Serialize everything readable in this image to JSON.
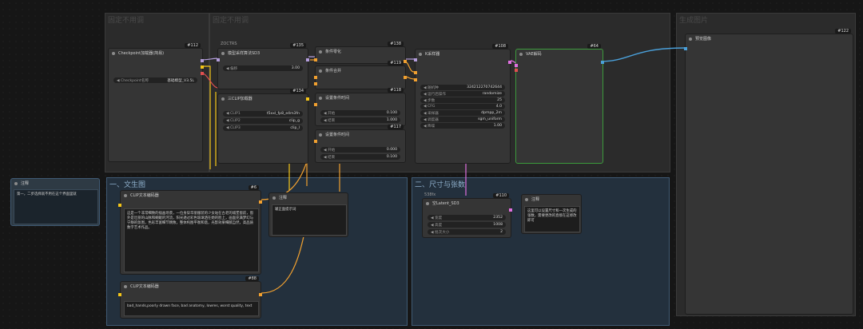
{
  "groups": {
    "g1": "固定不用调",
    "g2": "固定不用调",
    "g3": "生成图片",
    "g4": "一、文生图",
    "g5": "二、尺寸与张数"
  },
  "nodes": {
    "checkpoint": {
      "badge": "#112",
      "title": "Checkpoint加载器(简易)",
      "w_label": "Checkpoint名称",
      "w_value": "基础模型_V3.5L"
    },
    "sampler_sd3": {
      "sub": "ZOCTRS",
      "badge": "#135",
      "title": "模型采样算法SD3",
      "w_label": "偏移",
      "w_value": "3.00"
    },
    "condition_zero": {
      "badge": "#138",
      "title": "条件零化"
    },
    "condition_merge": {
      "badge": "#119",
      "title": "条件合并"
    },
    "clip_triple": {
      "badge": "#134",
      "title": "三CLIP加载器",
      "rows": [
        {
          "label": "CLIP1",
          "value": "t5xxl_fp8_e4m3fn"
        },
        {
          "label": "CLIP2",
          "value": "clip_g"
        },
        {
          "label": "CLIP3",
          "value": "clip_l"
        }
      ]
    },
    "set_cond_a": {
      "badge": "#118",
      "title": "设置条件时间",
      "rows": [
        {
          "label": "开始",
          "value": "0.100"
        },
        {
          "label": "结束",
          "value": "1.000"
        }
      ]
    },
    "set_cond_b": {
      "badge": "#117",
      "title": "设置条件时间",
      "rows": [
        {
          "label": "开始",
          "value": "0.000"
        },
        {
          "label": "结束",
          "value": "0.100"
        }
      ]
    },
    "ksampler": {
      "badge": "#108",
      "title": "K采样器",
      "rows": [
        {
          "label": "随机种",
          "value": "324212270742644"
        },
        {
          "label": "运行后操作",
          "value": "randomize"
        },
        {
          "label": "步数",
          "value": "25"
        },
        {
          "label": "CFG",
          "value": "4.0"
        },
        {
          "label": "采样器",
          "value": "dpmpp_2m"
        },
        {
          "label": "调度器",
          "value": "sgm_uniform"
        },
        {
          "label": "降噪",
          "value": "1.00"
        }
      ]
    },
    "vae": {
      "badge": "#64",
      "title": "VAE解码"
    },
    "preview": {
      "badge": "#122",
      "title": "预览图像"
    },
    "note_left": {
      "title": "注释",
      "text": "第一，二步选择就不用在这个界面里就"
    },
    "clip_text_pos": {
      "badge": "#6",
      "title": "CLIP文本编码器",
      "text": "这是一个非常细致的插画场景，一位身穿华丽服装的少女站在古老的城堡窗前，窗外是壮丽的山脉和蜿蜒的河流，阳光透过彩色玻璃洒在她的脸上，画面充满梦幻与宁静的氛围，色彩丰富细节精致，整体构图平衡和谐，光影效果细腻自然，高品质数字艺术作品。"
    },
    "note_mid": {
      "title": "注释",
      "text": "输正面提示词"
    },
    "clip_text_neg": {
      "badge": "#88",
      "title": "CLIP文本编码器",
      "text": "bad_hands,poorly drawn face, bad anatomy, lowres, worst quality, text"
    },
    "latent_sd3": {
      "sub": "538fx",
      "badge": "#110",
      "title": "空Latent_SD3",
      "rows": [
        {
          "label": "宽度",
          "value": "2352"
        },
        {
          "label": "高度",
          "value": "1008"
        },
        {
          "label": "批次大小",
          "value": "2"
        }
      ]
    },
    "note_right": {
      "title": "注释",
      "text": "这里可以设置尺寸和一次生成的张数，需要更改的直接在这修改即可"
    }
  },
  "colors": {
    "model": "#b39ddb",
    "clip": "#f5c518",
    "conditioning": "#f0a030",
    "latent": "#e070e0",
    "vae": "#e05050",
    "image": "#4a9fd8",
    "group_blue": "#23303d",
    "vae_border": "#3c9a3c"
  },
  "icons": {
    "triangle_left": "◀",
    "triangle_right": "▶"
  }
}
